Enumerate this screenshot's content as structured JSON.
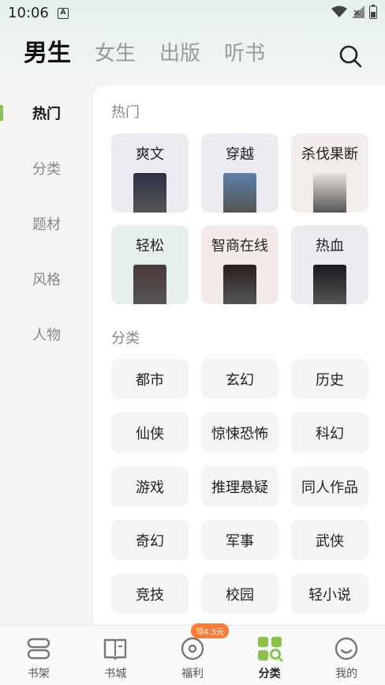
{
  "status": {
    "time": "10:06",
    "app_icon_letter": "A"
  },
  "top_tabs": [
    {
      "label": "男生",
      "active": true
    },
    {
      "label": "女生",
      "active": false
    },
    {
      "label": "出版",
      "active": false
    },
    {
      "label": "听书",
      "active": false
    }
  ],
  "left_nav": [
    {
      "label": "热门",
      "active": true
    },
    {
      "label": "分类",
      "active": false
    },
    {
      "label": "题材",
      "active": false
    },
    {
      "label": "风格",
      "active": false
    },
    {
      "label": "人物",
      "active": false
    }
  ],
  "hot": {
    "title": "热门",
    "items": [
      {
        "label": "爽文",
        "bg": "#ecebf2",
        "cover": "#2b3047"
      },
      {
        "label": "穿越",
        "bg": "#ecebf2",
        "cover": "#5d7fa8"
      },
      {
        "label": "杀伐果断",
        "bg": "#f2eceb",
        "cover": "#e8e2dc"
      },
      {
        "label": "轻松",
        "bg": "#e8f0ef",
        "cover": "#4a3a3a"
      },
      {
        "label": "智商在线",
        "bg": "#f3ebe9",
        "cover": "#2a1f1f"
      },
      {
        "label": "热血",
        "bg": "#ecebf2",
        "cover": "#1a1a1f"
      }
    ]
  },
  "categories": {
    "title": "分类",
    "items": [
      "都市",
      "玄幻",
      "历史",
      "仙侠",
      "惊悚恐怖",
      "科幻",
      "游戏",
      "推理悬疑",
      "同人作品",
      "奇幻",
      "军事",
      "武侠",
      "竞技",
      "校园",
      "轻小说"
    ]
  },
  "bottom_tabs": [
    {
      "label": "书架",
      "icon": "bookshelf-icon",
      "active": false
    },
    {
      "label": "书城",
      "icon": "book-city-icon",
      "active": false
    },
    {
      "label": "福利",
      "icon": "welfare-icon",
      "active": false,
      "badge": "领4.3元"
    },
    {
      "label": "分类",
      "icon": "category-icon",
      "active": true
    },
    {
      "label": "我的",
      "icon": "profile-icon",
      "active": false
    }
  ],
  "colors": {
    "accent": "#8bc34a",
    "badge": "#ff7a33"
  }
}
